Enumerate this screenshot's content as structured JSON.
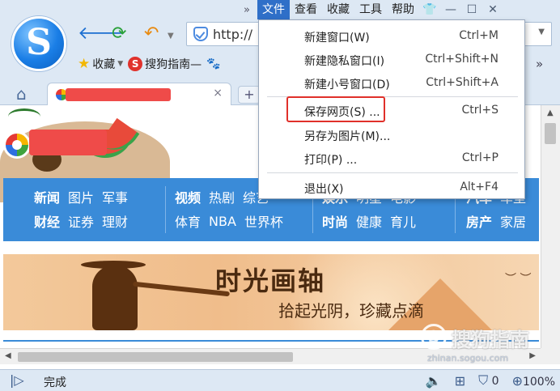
{
  "window": {
    "menu": [
      "文件",
      "查看",
      "收藏",
      "工具",
      "帮助"
    ],
    "active_menu_index": 0,
    "overflow_glyph": "»",
    "controls": {
      "skin": "👕",
      "minimize": "—",
      "maximize": "☐",
      "close": "✕"
    }
  },
  "browser": {
    "logo_letter": "S",
    "address": {
      "value": "http://"
    },
    "bookmarks": [
      {
        "label": "收藏",
        "icon": "star-icon"
      },
      {
        "label": "搜狗指南—",
        "icon": "sogou-icon",
        "icon_text": "S"
      },
      {
        "label": "",
        "icon": "paw-icon"
      }
    ],
    "tab": {
      "title": "",
      "close": "×"
    },
    "new_tab": "+",
    "nav_glyphs": {
      "back": "🡐",
      "refresh": "⟳",
      "undo": "↶"
    }
  },
  "file_menu": {
    "items": [
      {
        "label": "新建窗口(W)",
        "shortcut": "Ctrl+M"
      },
      {
        "label": "新建隐私窗口(I)",
        "shortcut": "Ctrl+Shift+N"
      },
      {
        "label": "新建小号窗口(D)",
        "shortcut": "Ctrl+Shift+A"
      },
      {
        "label": "保存网页(S) ...",
        "shortcut": "Ctrl+S",
        "highlighted": true
      },
      {
        "label": "另存为图片(M)...",
        "shortcut": ""
      },
      {
        "label": "打印(P) ...",
        "shortcut": "Ctrl+P"
      },
      {
        "label": "退出(X)",
        "shortcut": "Alt+F4"
      }
    ],
    "highlight_color": "#e0302a"
  },
  "page": {
    "nav_groups": [
      {
        "row1": [
          "新闻",
          "图片",
          "军事"
        ],
        "row2": [
          "财经",
          "证券",
          "理财"
        ],
        "bold": [
          "新闻",
          "财经"
        ]
      },
      {
        "row1": [
          "视频",
          "热剧",
          "综艺"
        ],
        "row2": [
          "体育",
          "NBA",
          "世界杯"
        ],
        "bold": [
          "视频"
        ]
      },
      {
        "row1": [
          "娱乐",
          "明星",
          "电影"
        ],
        "row2": [
          "时尚",
          "健康",
          "育儿"
        ],
        "bold": [
          "娱乐",
          "时尚"
        ]
      },
      {
        "row1": [
          "汽车",
          "车型"
        ],
        "row2": [
          "房产",
          "家居"
        ],
        "bold": [
          "汽车",
          "房产"
        ]
      }
    ],
    "banner": {
      "title": "时光画轴",
      "subtitle": "拾起光阴，珍藏点滴"
    },
    "nav_color": "#3a8bd8"
  },
  "watermark": {
    "mark": "S",
    "text": "搜狗指南",
    "url": "zhinan.sogou.com"
  },
  "statusbar": {
    "status": "完成",
    "sound_icon": "🔈",
    "ad_count": "0",
    "zoom": "100%"
  }
}
